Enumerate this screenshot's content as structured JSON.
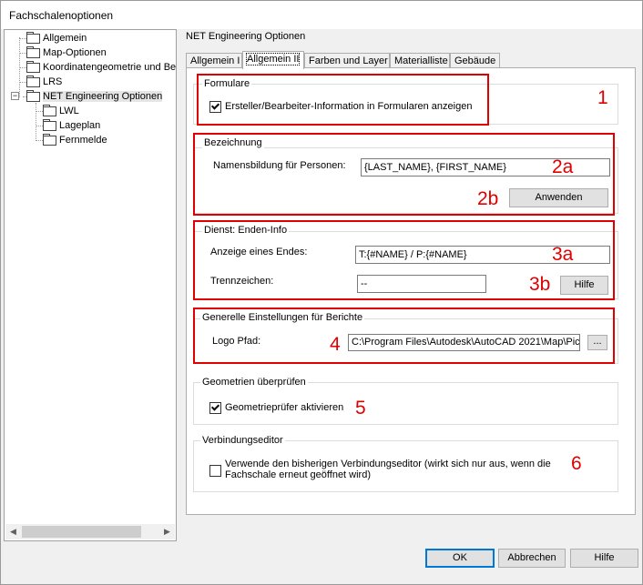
{
  "window": {
    "title": "Fachschalenoptionen"
  },
  "tree": {
    "items": [
      {
        "label": "Allgemein"
      },
      {
        "label": "Map-Optionen"
      },
      {
        "label": "Koordinatengeometrie und Berr"
      },
      {
        "label": "LRS"
      },
      {
        "label": "NET Engineering Optionen",
        "expander": "−"
      },
      {
        "label": "LWL"
      },
      {
        "label": "Lageplan"
      },
      {
        "label": "Fernmelde"
      }
    ],
    "scroll_left": "◀",
    "scroll_right": "▶"
  },
  "panel": {
    "title": "NET Engineering Optionen",
    "tabs": [
      {
        "label": "Allgemein I"
      },
      {
        "label": "Allgemein II"
      },
      {
        "label": "Farben und Layer"
      },
      {
        "label": "Materialliste"
      },
      {
        "label": "Gebäude"
      }
    ],
    "active_tab": "Allgemein II"
  },
  "formulare": {
    "label": "Formulare",
    "checkbox_label": "Ersteller/Bearbeiter-Information in Formularen anzeigen",
    "checked": true,
    "annotation": "1"
  },
  "bezeichnung": {
    "label": "Bezeichnung",
    "field_label": "Namensbildung für Personen:",
    "field_value": "{LAST_NAME}, {FIRST_NAME}",
    "apply_button": "Anwenden",
    "annotation_field": "2a",
    "annotation_button": "2b"
  },
  "dienst": {
    "label": "Dienst: Enden-Info",
    "field1_label": "Anzeige eines Endes:",
    "field1_value": "T:{#NAME} / P:{#NAME}",
    "field2_label": "Trennzeichen:",
    "field2_value": "--",
    "help_button": "Hilfe",
    "annotation_field": "3a",
    "annotation_button": "3b"
  },
  "berichte": {
    "label": "Generelle Einstellungen für Berichte",
    "field_label": "Logo Pfad:",
    "field_value": "C:\\Program Files\\Autodesk\\AutoCAD 2021\\Map\\Pic",
    "browse_button": "...",
    "annotation": "4"
  },
  "geometrie": {
    "label": "Geometrien überprüfen",
    "checkbox_label": "Geometrieprüfer aktivieren",
    "checked": true,
    "annotation": "5"
  },
  "verbindung": {
    "label": "Verbindungseditor",
    "checkbox_line1": "Verwende den bisherigen Verbindungseditor (wirkt sich nur aus, wenn die",
    "checkbox_line2": "Fachschale erneut geöffnet wird)",
    "checked": false,
    "annotation": "6"
  },
  "footer": {
    "ok": "OK",
    "cancel": "Abbrechen",
    "help": "Hilfe"
  },
  "colors": {
    "annotation_red": "#e00000",
    "default_button_border": "#0078d7"
  }
}
